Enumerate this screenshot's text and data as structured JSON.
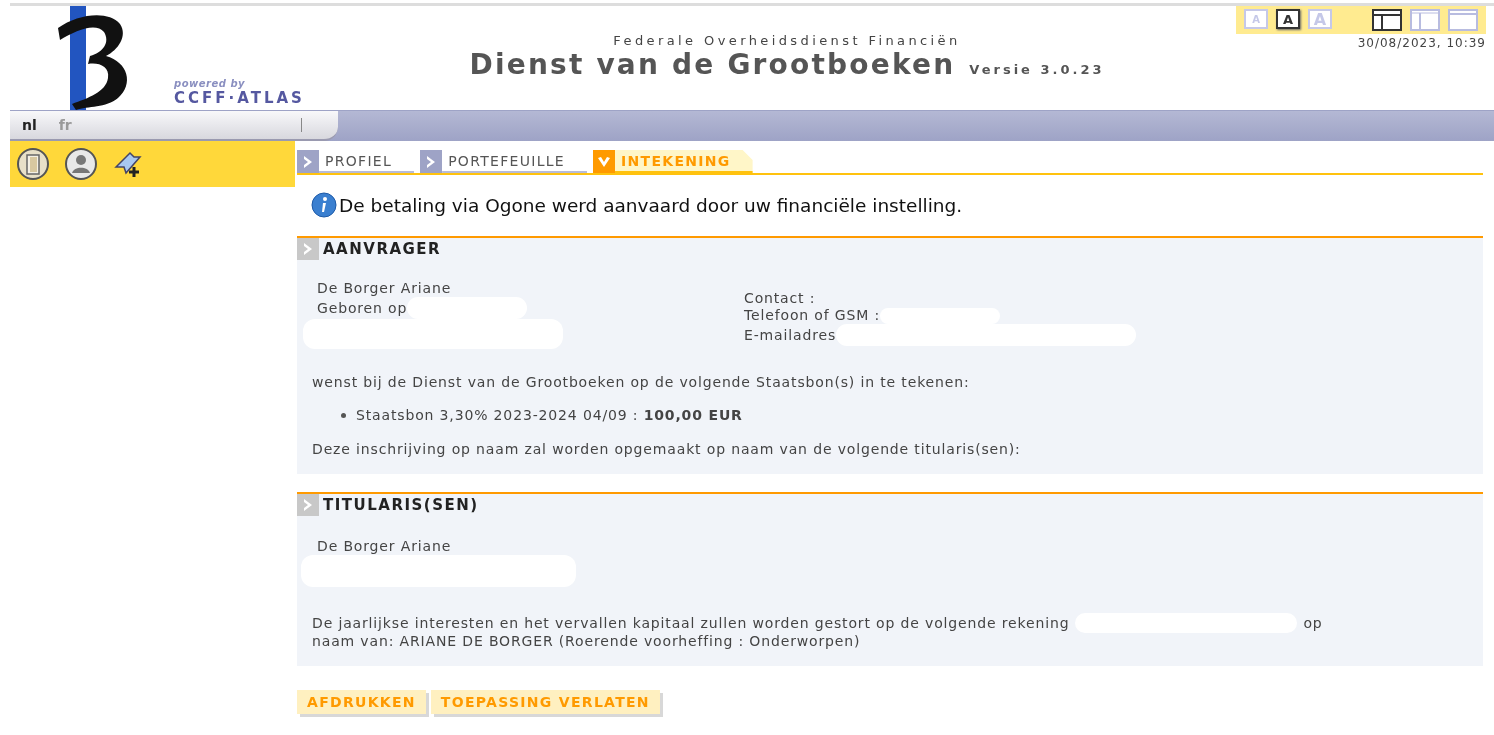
{
  "header": {
    "logo_tagline": "powered by",
    "logo_brand": "CCFF·ATLAS",
    "agency": "Federale Overheidsdienst Financiën",
    "title": "Dienst van de Grootboeken",
    "version": "Versie 3.0.23",
    "font_sizes": [
      {
        "label": "A",
        "kind": "small",
        "selected": false
      },
      {
        "label": "A",
        "kind": "medium",
        "selected": true
      },
      {
        "label": "A",
        "kind": "large",
        "selected": false
      }
    ],
    "layouts": [
      {
        "kind": "header-sidebar",
        "selected": true
      },
      {
        "kind": "sidebar",
        "selected": false
      },
      {
        "kind": "header",
        "selected": false
      }
    ],
    "datetime": "30/08/2023, 10:39"
  },
  "languages": [
    {
      "label": "nl",
      "selected": true
    },
    {
      "label": "fr",
      "selected": false
    }
  ],
  "tabs": [
    {
      "label": "PROFIEL",
      "selected": false
    },
    {
      "label": "PORTEFEUILLE",
      "selected": false
    },
    {
      "label": "INTEKENING",
      "selected": true
    }
  ],
  "message": "De betaling via Ogone werd aanvaard door uw financiële instelling.",
  "applicant": {
    "title": "AANVRAGER",
    "name": "De Borger Ariane",
    "birth_label": "Geboren op",
    "contact_lines": [
      "Contact :",
      "Telefoon of GSM :",
      "E-mailadres"
    ],
    "intro": "wenst bij de Dienst van de Grootboeken op de volgende Staatsbon(s) in te tekenen:",
    "bonds": [
      "Staatsbon 3,30% 2023-2024 04/09 : **100,00 EUR**"
    ],
    "outro": "Deze inschrijving op naam zal worden opgemaakt op naam van de volgende titularis(sen):"
  },
  "holders": {
    "title": "TITULARIS(SEN)",
    "names": [
      "De Borger Ariane"
    ],
    "account_before": "De jaarlijkse interesten en het vervallen kapitaal zullen worden gestort op de volgende rekening",
    "account_after": "op",
    "account_continued": "naam van: ARIANE DE BORGER (Roerende voorheffing : Onderworpen)"
  },
  "buttons": [
    "AFDRUKKEN",
    "TOEPASSING VERLATEN"
  ]
}
